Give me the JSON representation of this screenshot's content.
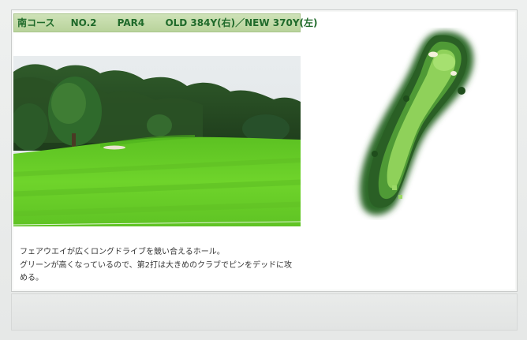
{
  "header": {
    "course": "南コース",
    "hole": "NO.2",
    "par": "PAR4",
    "distance": "OLD 384Y(右)／NEW 370Y(左)"
  },
  "photo": {
    "alt": "Fairway photo"
  },
  "map": {
    "alt": "Hole layout map"
  },
  "description": {
    "line1": "フェアウエイが広くロングドライブを競い合えるホール。",
    "line2": "グリーンが高くなっているので、第2打は大きめのクラブでピンをデッドに攻",
    "line3": "める。"
  },
  "colors": {
    "header_text": "#1f6a2a",
    "header_bg": "#c4dba8",
    "fairway": "#6fcf2a"
  }
}
